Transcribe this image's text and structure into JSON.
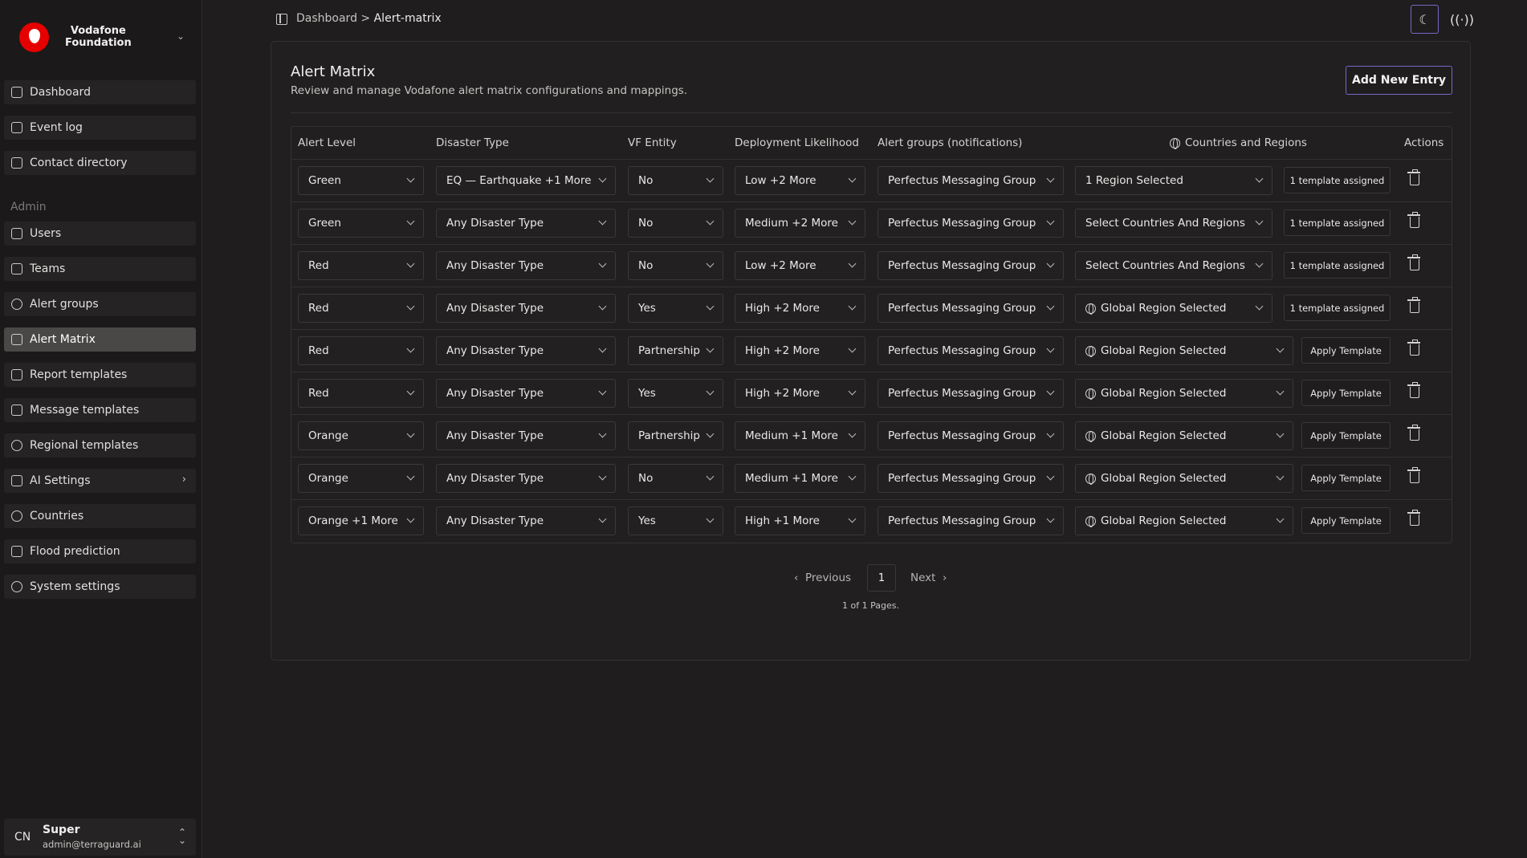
{
  "brand": {
    "name_line1": "Vodafone",
    "name_line2": "Foundation"
  },
  "sidebar": {
    "items": [
      {
        "label": "Dashboard",
        "icon": "home-icon"
      },
      {
        "label": "Event log",
        "icon": "log-icon"
      },
      {
        "label": "Contact directory",
        "icon": "contacts-icon"
      }
    ],
    "admin_label": "Admin",
    "admin_items": [
      {
        "label": "Users",
        "icon": "users-icon"
      },
      {
        "label": "Teams",
        "icon": "teams-icon"
      },
      {
        "label": "Alert groups",
        "icon": "alert-groups-icon"
      },
      {
        "label": "Alert Matrix",
        "icon": "matrix-icon",
        "active": true
      },
      {
        "label": "Report templates",
        "icon": "report-icon"
      },
      {
        "label": "Message templates",
        "icon": "message-icon"
      },
      {
        "label": "Regional templates",
        "icon": "globe-icon"
      },
      {
        "label": "AI Settings",
        "icon": "sparkle-icon"
      },
      {
        "label": "Countries",
        "icon": "countries-icon"
      },
      {
        "label": "Flood prediction",
        "icon": "cloud-icon"
      },
      {
        "label": "System settings",
        "icon": "gear-icon"
      }
    ]
  },
  "user": {
    "initials": "CN",
    "name": "Super",
    "email": "admin@terraguard.ai"
  },
  "breadcrumb": {
    "root": "Dashboard",
    "separator": ">",
    "current": "Alert-matrix"
  },
  "page": {
    "title": "Alert Matrix",
    "subtitle": "Review and manage Vodafone alert matrix configurations and mappings.",
    "add_button": "Add New Entry"
  },
  "table": {
    "headers": {
      "alert_level": "Alert Level",
      "disaster_type": "Disaster Type",
      "vf_entity": "VF Entity",
      "deployment": "Deployment Likelihood",
      "groups": "Alert groups (notifications)",
      "regions": "Countries and Regions",
      "actions": "Actions"
    },
    "rows": [
      {
        "alert_level": "Green",
        "disaster_type": "EQ — Earthquake +1 More",
        "vf_entity": "No",
        "deployment": "Low +2 More",
        "group": "Perfectus Messaging Group",
        "region": "1 Region Selected",
        "region_globe": false,
        "template": "1 template assigned"
      },
      {
        "alert_level": "Green",
        "disaster_type": "Any Disaster Type",
        "vf_entity": "No",
        "deployment": "Medium +2 More",
        "group": "Perfectus Messaging Group",
        "region": "Select Countries And Regions",
        "region_globe": false,
        "template": "1 template assigned"
      },
      {
        "alert_level": "Red",
        "disaster_type": "Any Disaster Type",
        "vf_entity": "No",
        "deployment": "Low +2 More",
        "group": "Perfectus Messaging Group",
        "region": "Select Countries And Regions",
        "region_globe": false,
        "template": "1 template assigned"
      },
      {
        "alert_level": "Red",
        "disaster_type": "Any Disaster Type",
        "vf_entity": "Yes",
        "deployment": "High +2 More",
        "group": "Perfectus Messaging Group",
        "region": "Global Region Selected",
        "region_globe": true,
        "template": "1 template assigned"
      },
      {
        "alert_level": "Red",
        "disaster_type": "Any Disaster Type",
        "vf_entity": "Partnership",
        "deployment": "High +2 More",
        "group": "Perfectus Messaging Group",
        "region": "Global Region Selected",
        "region_globe": true,
        "template": "Apply Template"
      },
      {
        "alert_level": "Red",
        "disaster_type": "Any Disaster Type",
        "vf_entity": "Yes",
        "deployment": "High +2 More",
        "group": "Perfectus Messaging Group",
        "region": "Global Region Selected",
        "region_globe": true,
        "template": "Apply Template"
      },
      {
        "alert_level": "Orange",
        "disaster_type": "Any Disaster Type",
        "vf_entity": "Partnership",
        "deployment": "Medium +1 More",
        "group": "Perfectus Messaging Group",
        "region": "Global Region Selected",
        "region_globe": true,
        "template": "Apply Template"
      },
      {
        "alert_level": "Orange",
        "disaster_type": "Any Disaster Type",
        "vf_entity": "No",
        "deployment": "Medium +1 More",
        "group": "Perfectus Messaging Group",
        "region": "Global Region Selected",
        "region_globe": true,
        "template": "Apply Template"
      },
      {
        "alert_level": "Orange +1 More",
        "disaster_type": "Any Disaster Type",
        "vf_entity": "Yes",
        "deployment": "High +1 More",
        "group": "Perfectus Messaging Group",
        "region": "Global Region Selected",
        "region_globe": true,
        "template": "Apply Template"
      }
    ]
  },
  "pagination": {
    "previous": "Previous",
    "next": "Next",
    "current": "1",
    "info": "1 of 1 Pages."
  },
  "colors": {
    "accent": "#7b65c9",
    "background": "#1f1d1d",
    "sidebar": "#1b1919"
  }
}
